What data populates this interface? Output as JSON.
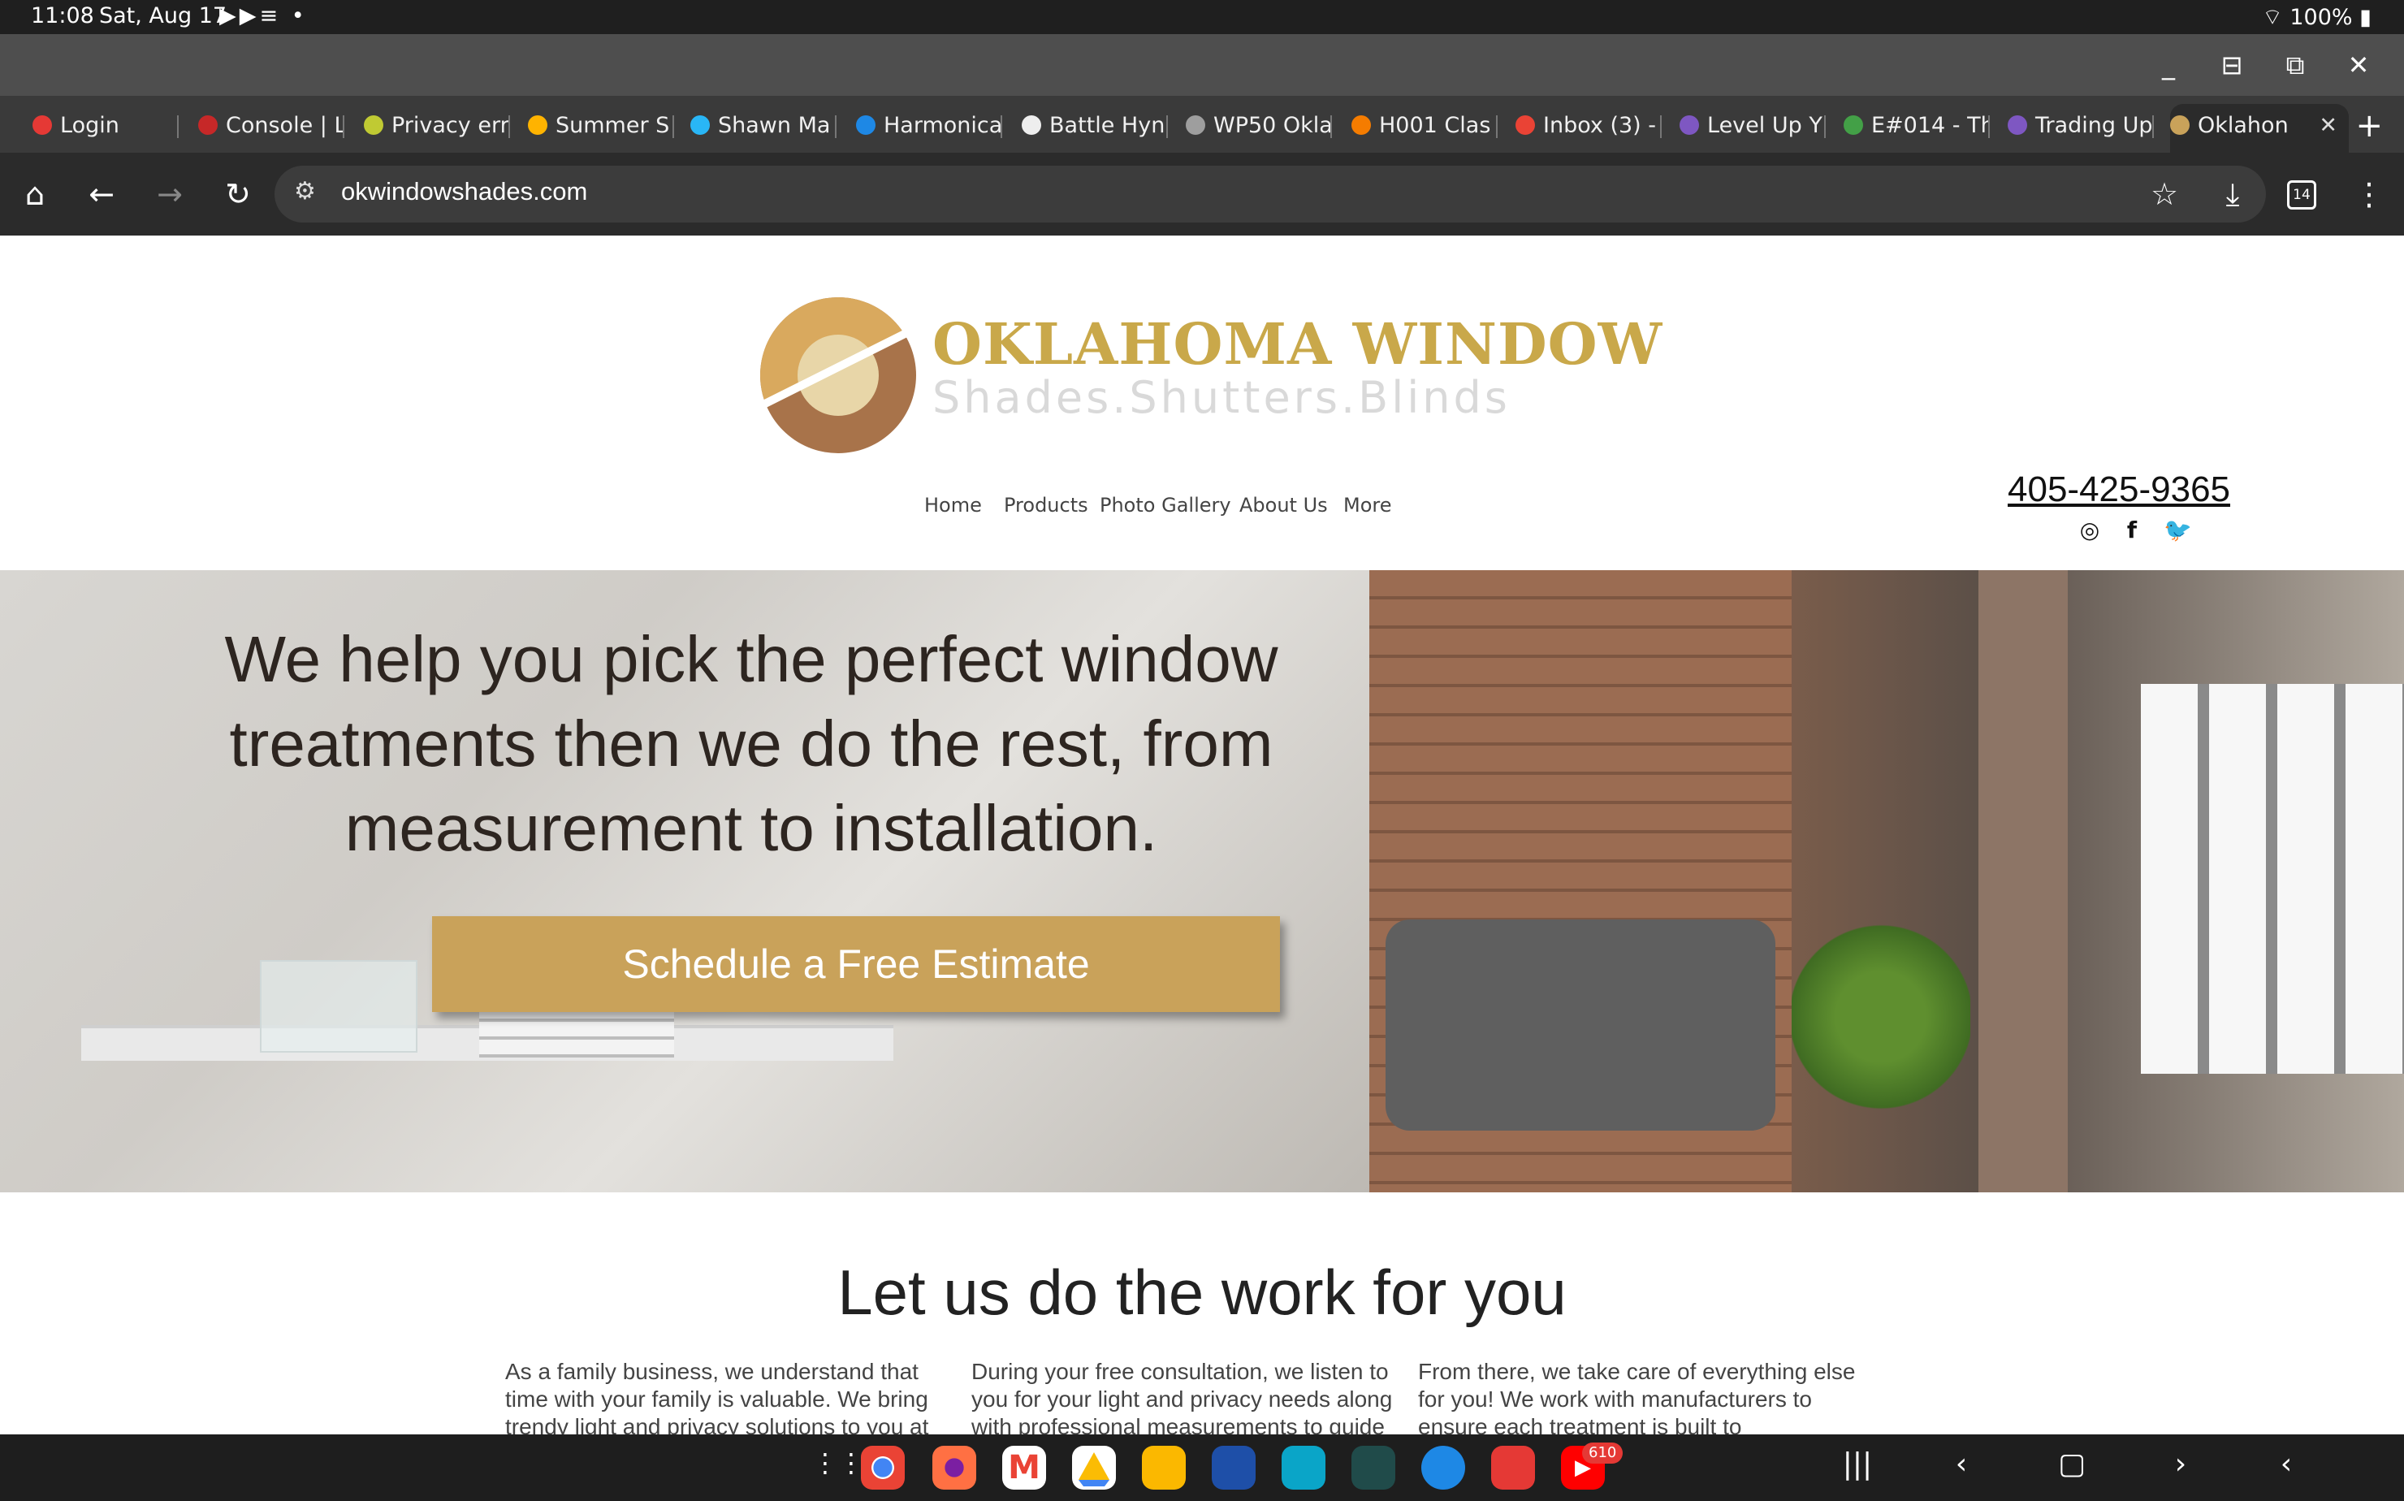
{
  "status": {
    "time": "11:08",
    "date": "Sat, Aug 17",
    "battery": "100%"
  },
  "tabs": [
    {
      "label": "Login",
      "color": "#e53935"
    },
    {
      "label": "Console | L",
      "color": "#c62828"
    },
    {
      "label": "Privacy err",
      "color": "#c0ca33"
    },
    {
      "label": "Summer S",
      "color": "#ffb300"
    },
    {
      "label": "Shawn Ma",
      "color": "#29b6f6"
    },
    {
      "label": "Harmonica",
      "color": "#1e88e5"
    },
    {
      "label": "Battle Hyn",
      "color": "#eeeeee"
    },
    {
      "label": "WP50 Okla",
      "color": "#9e9e9e"
    },
    {
      "label": "H001 Clas",
      "color": "#f57c00"
    },
    {
      "label": "Inbox (3) -",
      "color": "#ea4335"
    },
    {
      "label": "Level Up Y",
      "color": "#7e57c2"
    },
    {
      "label": "E#014 - Th",
      "color": "#43a047"
    },
    {
      "label": "Trading Up",
      "color": "#7e57c2"
    },
    {
      "label": "Oklahon",
      "color": "#c9a25a"
    }
  ],
  "toolbar": {
    "url": "okwindowshades.com",
    "tab_count": "14"
  },
  "site": {
    "logo_title": "OKLAHOMA WINDOW",
    "logo_subtitle": "Shades.Shutters.Blinds",
    "nav": [
      "Home",
      "Products",
      "Photo Gallery",
      "About Us",
      "More"
    ],
    "phone": "405-425-9365",
    "hero_headline": "We help you pick the perfect window treatments then we do the rest, from measurement to installation.",
    "cta_label": "Schedule a Free Estimate",
    "section_title": "Let us do the work for you",
    "columns": [
      "As a family business, we understand that time with your family is valuable. We bring trendy light and privacy solutions to you at",
      "During your free consultation, we listen to you for your light and privacy needs along with professional measurements to guide",
      "From there, we take care of everything else for you! We work with manufacturers to ensure each treatment is built to"
    ]
  },
  "taskbar": {
    "youtube_badge": "610"
  },
  "colors": {
    "brand_gold": "#c9a84a",
    "cta_gold": "#c9a25a",
    "logo_brown": "#a8734a"
  }
}
